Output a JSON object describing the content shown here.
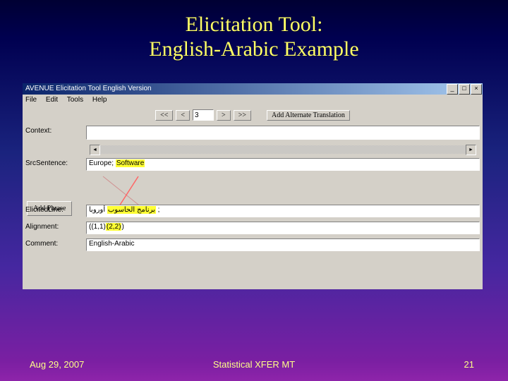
{
  "slide": {
    "title_line1": "Elicitation Tool:",
    "title_line2": "English-Arabic Example",
    "date": "Aug 29, 2007",
    "footer_center": "Statistical XFER MT",
    "page_num": "21"
  },
  "win": {
    "title": "AVENUE Elicitation Tool English Version",
    "sys": {
      "min": "_",
      "max": "□",
      "close": "×"
    },
    "menu": {
      "file": "File",
      "edit": "Edit",
      "tools": "Tools",
      "help": "Help"
    },
    "toolbar": {
      "first": "<<",
      "prev": "<",
      "index": "3",
      "next": ">",
      "last": ">>",
      "add_alt": "Add Alternate Translation"
    },
    "labels": {
      "context": "Context:",
      "source": "SrcSentence:",
      "elicited": "ElicitedLine:",
      "alignment": "Alignment:",
      "comment": "Comment:"
    },
    "values": {
      "context": "",
      "src_plain1": "Europe;",
      "src_highlight": "Software",
      "elicited_highlight": "ﺑﺮﻧﺎﻣﺞ اﻟﺤﺎﺳﻮب",
      "elicited_plain": "أوروبا ;",
      "alignment_pre": "((1,1)",
      "alignment_hi": "(2,2)",
      "alignment_post": ")",
      "comment": "English-Arabic"
    },
    "buttons": {
      "add_phrase": "Add Phrase"
    }
  }
}
